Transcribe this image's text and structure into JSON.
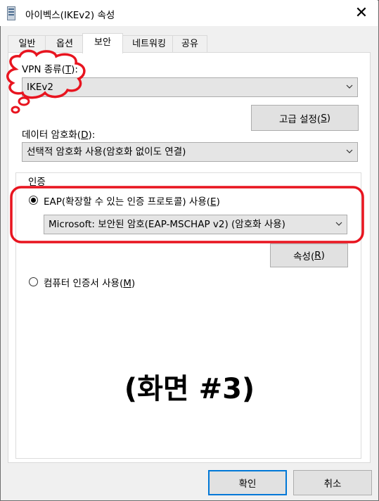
{
  "window": {
    "title": "아이벡스(IKEv2) 속성",
    "close_glyph": "✕"
  },
  "tabs": [
    {
      "label": "일반"
    },
    {
      "label": "옵션"
    },
    {
      "label": "보안",
      "active": true
    },
    {
      "label": "네트워킹"
    },
    {
      "label": "공유"
    }
  ],
  "vpn_type": {
    "label_pre": "VPN 종류(",
    "label_key": "T",
    "label_post": "):",
    "value": "IKEv2"
  },
  "advanced_button": {
    "pre": "고급 설정(",
    "key": "S",
    "post": ")"
  },
  "encryption": {
    "label_pre": "데이터 암호화(",
    "label_key": "D",
    "label_post": "):",
    "value": "선택적 암호화 사용(암호화 없이도 연결)"
  },
  "auth": {
    "group_label": "인증",
    "eap": {
      "label_pre": "EAP(확장할 수 있는 인증 프로토콜) 사용(",
      "label_key": "E",
      "label_post": ")",
      "selected": true,
      "value": "Microsoft: 보안된 암호(EAP-MSCHAP v2) (암호화 사용)"
    },
    "properties_button": {
      "pre": "속성(",
      "key": "R",
      "post": ")"
    },
    "certificate": {
      "label_pre": "컴퓨터 인증서 사용(",
      "label_key": "M",
      "label_post": ")",
      "selected": false
    }
  },
  "caption": "(화면 #3)",
  "footer": {
    "ok": "확인",
    "cancel": "취소"
  },
  "colors": {
    "annotation_red": "#e8141f",
    "focus_blue": "#0078d7"
  }
}
